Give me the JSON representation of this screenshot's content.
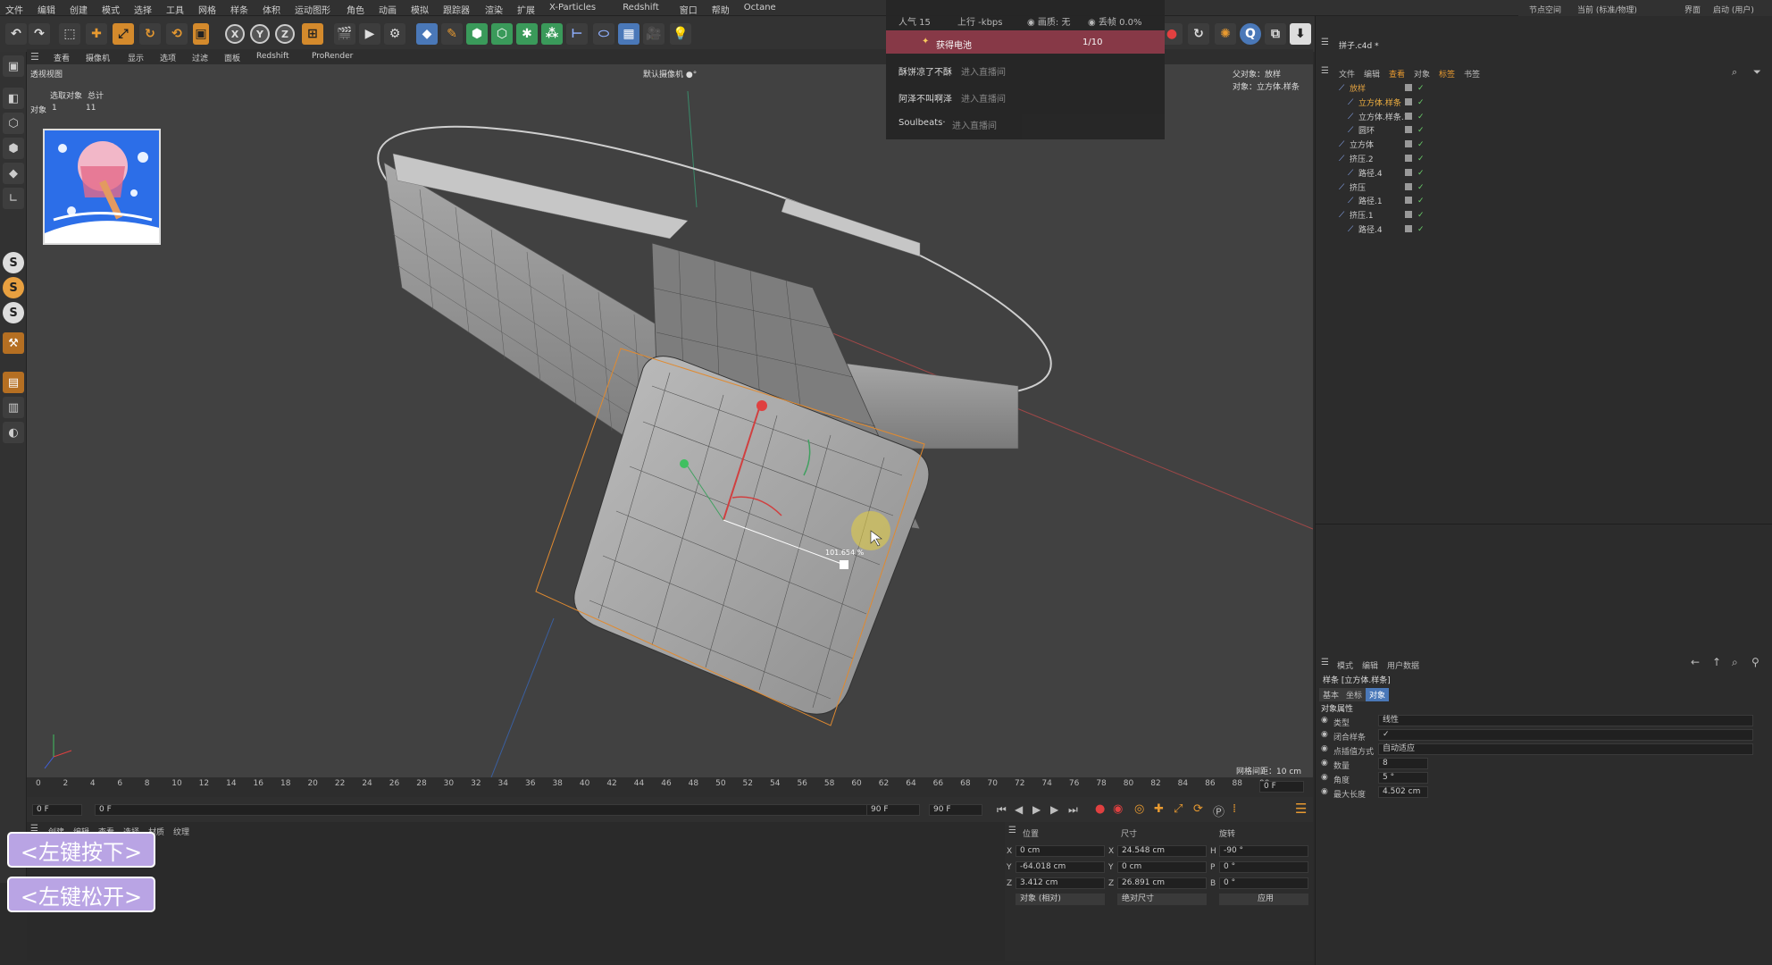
{
  "menubar": {
    "items": [
      "文件",
      "编辑",
      "创建",
      "模式",
      "选择",
      "工具",
      "网格",
      "样条",
      "体积",
      "运动图形",
      "角色",
      "动画",
      "模拟",
      "跟踪器",
      "渲染",
      "扩展",
      "X-Particles",
      "Redshift",
      "窗口",
      "帮助",
      "Octane"
    ],
    "right": [
      "节点空间",
      "当前 (标准/物理)",
      "界面",
      "启动 (用户)"
    ]
  },
  "toolbar": {
    "icons": [
      "undo-icon",
      "redo-icon",
      "select-icon",
      "move-icon",
      "scale-icon",
      "rotate-icon",
      "recent-icon",
      "x-axis-icon",
      "y-axis-icon",
      "z-axis-icon",
      "coord-icon",
      "render-view-icon",
      "render-icon",
      "render-settings-icon",
      "cube-icon",
      "pen-icon",
      "subdivision-icon",
      "cloner-icon",
      "deformer-icon",
      "field-icon",
      "camera-icon",
      "light-icon"
    ],
    "axis": [
      "X",
      "Y",
      "Z"
    ]
  },
  "viewport_menu": [
    "查看",
    "摄像机",
    "显示",
    "选项",
    "过滤",
    "面板",
    "Redshift",
    "ProRender"
  ],
  "viewport": {
    "label": "透视视图",
    "camera": "默认摄像机 ●°",
    "info_header": [
      "选取对象",
      "总计"
    ],
    "info_row": [
      "对象",
      "1",
      "11"
    ],
    "parent_obj": "父对象：放样",
    "obj_label": "对象：立方体.样条",
    "measure": "101.654 %",
    "grid_spacing": "网格间距：10 cm"
  },
  "live_overlay": {
    "popularity": "人气 15",
    "upload": "上行 -kbps",
    "quality": "画质: 无",
    "drop": "丢帧 0.0%",
    "battery_label": "获得电池",
    "battery_count": "1/10",
    "rows": [
      {
        "name": "酥饼凉了不酥",
        "action": "进入直播间"
      },
      {
        "name": "阿泽不叫啊泽",
        "action": "进入直播间"
      },
      {
        "name": "Soulbeats·",
        "action": "进入直播间"
      }
    ]
  },
  "timeline": {
    "ticks": [
      "0",
      "2",
      "4",
      "6",
      "8",
      "10",
      "12",
      "14",
      "16",
      "18",
      "20",
      "22",
      "24",
      "26",
      "28",
      "30",
      "32",
      "34",
      "36",
      "38",
      "40",
      "42",
      "44",
      "46",
      "48",
      "50",
      "52",
      "54",
      "56",
      "58",
      "60",
      "62",
      "64",
      "66",
      "68",
      "70",
      "72",
      "74",
      "76",
      "78",
      "80",
      "82",
      "84",
      "86",
      "88",
      "90"
    ],
    "frame_end_box": "0 F",
    "start": "0 F",
    "cur": "0 F",
    "end1": "90 F",
    "end2": "90 F"
  },
  "mat_tabs": [
    "创建",
    "编辑",
    "查看",
    "选择",
    "材质",
    "纹理"
  ],
  "coords": {
    "headers": [
      "位置",
      "尺寸",
      "旋转"
    ],
    "rows": [
      {
        "axis": "X",
        "pos": "0 cm",
        "size_axis": "X",
        "size": "24.548 cm",
        "rot_axis": "H",
        "rot": "-90 °"
      },
      {
        "axis": "Y",
        "pos": "-64.018 cm",
        "size_axis": "Y",
        "size": "0 cm",
        "rot_axis": "P",
        "rot": "0 °"
      },
      {
        "axis": "Z",
        "pos": "3.412 cm",
        "size_axis": "Z",
        "size": "26.891 cm",
        "rot_axis": "B",
        "rot": "0 °"
      }
    ],
    "mode1": "对象 (相对)",
    "mode2": "绝对尺寸",
    "apply": "应用"
  },
  "right": {
    "file_title": "拼子.c4d *",
    "obj_menu": [
      "文件",
      "编辑",
      "查看",
      "对象",
      "标签",
      "书签"
    ],
    "objects": [
      {
        "name": "放样",
        "indent": 0,
        "color": "#e0a040"
      },
      {
        "name": "立方体.样条",
        "indent": 1,
        "color": "#f0b040"
      },
      {
        "name": "立方体.样条.1",
        "indent": 1,
        "color": "#cccccc"
      },
      {
        "name": "圆环",
        "indent": 1,
        "color": "#cccccc"
      },
      {
        "name": "立方体",
        "indent": 0,
        "color": "#cccccc"
      },
      {
        "name": "挤压.2",
        "indent": 0,
        "color": "#cccccc"
      },
      {
        "name": "路径.4",
        "indent": 1,
        "color": "#cccccc"
      },
      {
        "name": "挤压",
        "indent": 0,
        "color": "#cccccc"
      },
      {
        "name": "路径.1",
        "indent": 1,
        "color": "#cccccc"
      },
      {
        "name": "挤压.1",
        "indent": 0,
        "color": "#cccccc"
      },
      {
        "name": "路径.4",
        "indent": 1,
        "color": "#cccccc"
      }
    ],
    "attr_menu": [
      "模式",
      "编辑",
      "用户数据"
    ],
    "attr_title": "样条 [立方体.样条]",
    "attr_tabs": [
      "基本",
      "坐标",
      "对象"
    ],
    "section": "对象属性",
    "props": [
      {
        "label": "类型",
        "value": "线性"
      },
      {
        "label": "闭合样条",
        "value": "✓"
      },
      {
        "label": "点插值方式",
        "value": "自动适应"
      },
      {
        "label": "数量",
        "value": "8"
      },
      {
        "label": "角度",
        "value": "5 °"
      },
      {
        "label": "最大长度",
        "value": "4.502 cm"
      }
    ]
  },
  "buttons": {
    "left_down": "<左键按下>",
    "left_up": "<左键松开>"
  }
}
